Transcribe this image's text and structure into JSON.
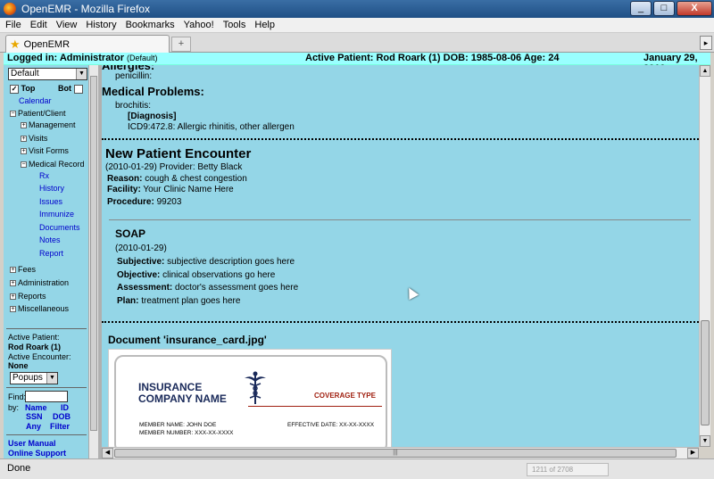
{
  "window": {
    "title": "OpenEMR - Mozilla Firefox",
    "buttons": {
      "minimize": "_",
      "maximize": "□",
      "close": "X"
    }
  },
  "menubar": [
    "File",
    "Edit",
    "View",
    "History",
    "Bookmarks",
    "Yahoo!",
    "Tools",
    "Help"
  ],
  "tabs": [
    {
      "label": "OpenEMR"
    }
  ],
  "newtab_label": "+",
  "header": {
    "logged_in": "Logged in: Administrator",
    "logged_in_group": "(Default)",
    "active_patient": "Active Patient: Rod Roark (1) DOB: 1985-08-06 Age: 24",
    "date": "January 29, 2010"
  },
  "nav": {
    "view_select": "Default",
    "top_label": "Top",
    "top_checked": true,
    "bot_label": "Bot",
    "bot_checked": false,
    "calendar": "Calendar",
    "patient_client": "Patient/Client",
    "management": "Management",
    "visits": "Visits",
    "visit_forms": "Visit Forms",
    "medical_record": "Medical Record",
    "medical_record_items": [
      "Rx",
      "History",
      "Issues",
      "Immunize",
      "Documents",
      "Notes",
      "Report"
    ],
    "fees": "Fees",
    "administration": "Administration",
    "reports": "Reports",
    "miscellaneous": "Miscellaneous",
    "active_patient_label": "Active Patient:",
    "active_patient_name": "Rod Roark (1)",
    "active_encounter_label": "Active Encounter:",
    "active_encounter_value": "None",
    "popups_select": "Popups",
    "find_label": "Find:",
    "by_label": "by:",
    "find_options": [
      "Name",
      "ID",
      "SSN",
      "DOB",
      "Any",
      "Filter"
    ],
    "user_manual": "User Manual",
    "online_support": "Online Support"
  },
  "main": {
    "allergies_heading": "Allergies:",
    "allergy_item": "penicillin:",
    "medical_problems_heading": "Medical Problems:",
    "problem_item": "brochitis:",
    "diagnosis_label": "[Diagnosis]",
    "diagnosis_code": "ICD9:472.8: Allergic rhinitis, other allergen",
    "encounter_heading": "New Patient Encounter",
    "encounter_date_provider": "(2010-01-29) Provider: Betty Black",
    "reason_label": "Reason:",
    "reason_value": "cough & chest congestion",
    "facility_label": "Facility:",
    "facility_value": "Your Clinic Name Here",
    "procedure_label": "Procedure:",
    "procedure_value": "99203",
    "soap_heading": "SOAP",
    "soap_date": "(2010-01-29)",
    "subjective_label": "Subjective:",
    "subjective_value": "subjective description goes here",
    "objective_label": "Objective:",
    "objective_value": "clinical observations go here",
    "assessment_label": "Assessment:",
    "assessment_value": "doctor's assessment goes here",
    "plan_label": "Plan:",
    "plan_value": "treatment plan goes here",
    "document_heading": "Document 'insurance_card.jpg'",
    "card": {
      "line1": "INSURANCE",
      "line2": "COMPANY NAME",
      "coverage": "COVERAGE TYPE",
      "member_name": "MEMBER NAME:  JOHN DOE",
      "member_number": "MEMBER NUMBER: XXX-XX-XXXX",
      "effective_date": "EFFECTIVE DATE: XX-XX-XXXX"
    }
  },
  "statusbar": {
    "status": "Done",
    "page_counter": "1211 of 2708"
  }
}
